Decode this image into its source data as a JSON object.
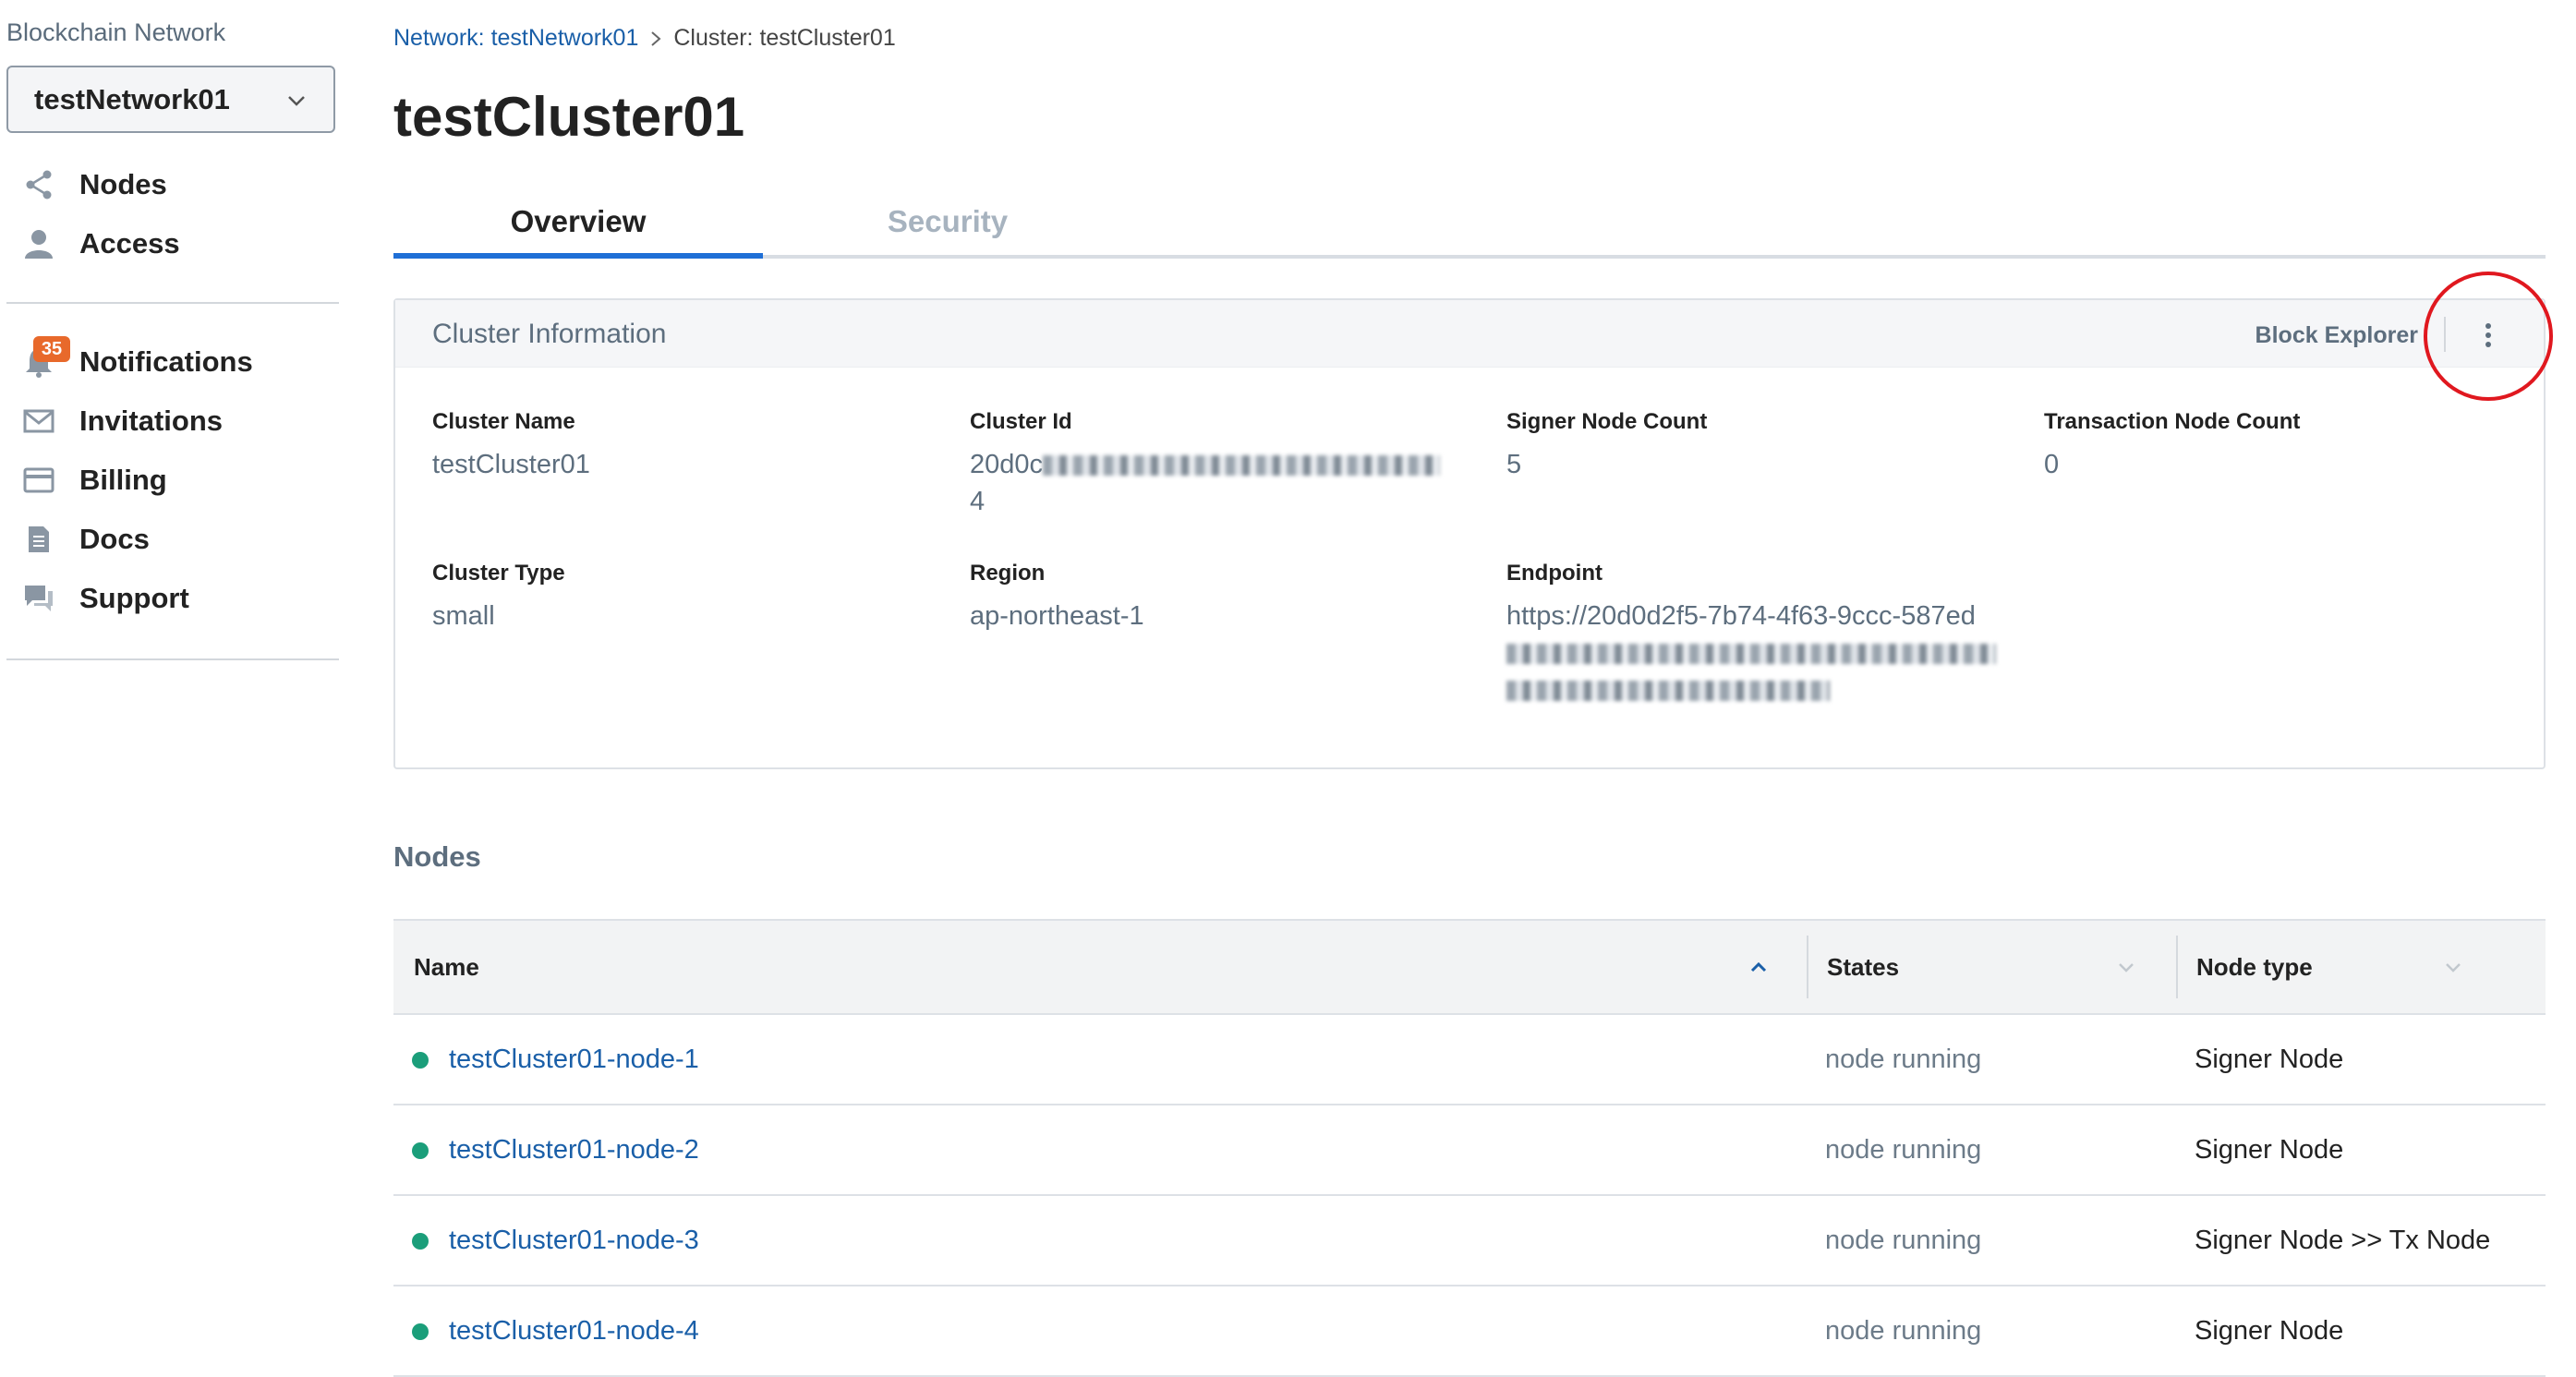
{
  "sidebar": {
    "title": "Blockchain Network",
    "network_selector": {
      "value": "testNetwork01",
      "icon": "chevron-down-icon"
    },
    "primary_nav": [
      {
        "label": "Nodes",
        "icon": "share-icon"
      },
      {
        "label": "Access",
        "icon": "person-icon"
      }
    ],
    "secondary_nav": [
      {
        "label": "Notifications",
        "icon": "bell-icon",
        "badge": "35"
      },
      {
        "label": "Invitations",
        "icon": "mail-icon"
      },
      {
        "label": "Billing",
        "icon": "credit-card-icon"
      },
      {
        "label": "Docs",
        "icon": "document-icon"
      },
      {
        "label": "Support",
        "icon": "chat-icon"
      }
    ]
  },
  "breadcrumb": {
    "network_link": "Network: testNetwork01",
    "current": "Cluster: testCluster01"
  },
  "page_title": "testCluster01",
  "tabs": [
    {
      "label": "Overview",
      "active": true
    },
    {
      "label": "Security",
      "active": false
    }
  ],
  "cluster_info": {
    "title": "Cluster Information",
    "block_explorer_label": "Block Explorer",
    "fields": {
      "cluster_name": {
        "label": "Cluster Name",
        "value": "testCluster01"
      },
      "cluster_id": {
        "label": "Cluster Id",
        "value_prefix": "20d0c",
        "value_suffix": "4"
      },
      "signer_node_count": {
        "label": "Signer Node Count",
        "value": "5"
      },
      "transaction_node_count": {
        "label": "Transaction Node Count",
        "value": "0"
      },
      "cluster_type": {
        "label": "Cluster Type",
        "value": "small"
      },
      "region": {
        "label": "Region",
        "value": "ap-northeast-1"
      },
      "endpoint": {
        "label": "Endpoint",
        "value_visible": "https://20d0d2f5-7b74-4f63-9ccc-587ed"
      }
    }
  },
  "nodes": {
    "title": "Nodes",
    "columns": [
      {
        "label": "Name",
        "sort": "ascending"
      },
      {
        "label": "States",
        "sort": "none"
      },
      {
        "label": "Node type",
        "sort": "none"
      }
    ],
    "rows": [
      {
        "name": "testCluster01-node-1",
        "state": "node running",
        "type": "Signer Node"
      },
      {
        "name": "testCluster01-node-2",
        "state": "node running",
        "type": "Signer Node"
      },
      {
        "name": "testCluster01-node-3",
        "state": "node running",
        "type": "Signer Node >> Tx Node"
      },
      {
        "name": "testCluster01-node-4",
        "state": "node running",
        "type": "Signer Node"
      }
    ]
  },
  "colors": {
    "accent": "#1f6fd6",
    "link": "#1a5fa8",
    "status_running": "#1b9e7a",
    "badge": "#e8692b",
    "highlight": "#e0181f"
  }
}
